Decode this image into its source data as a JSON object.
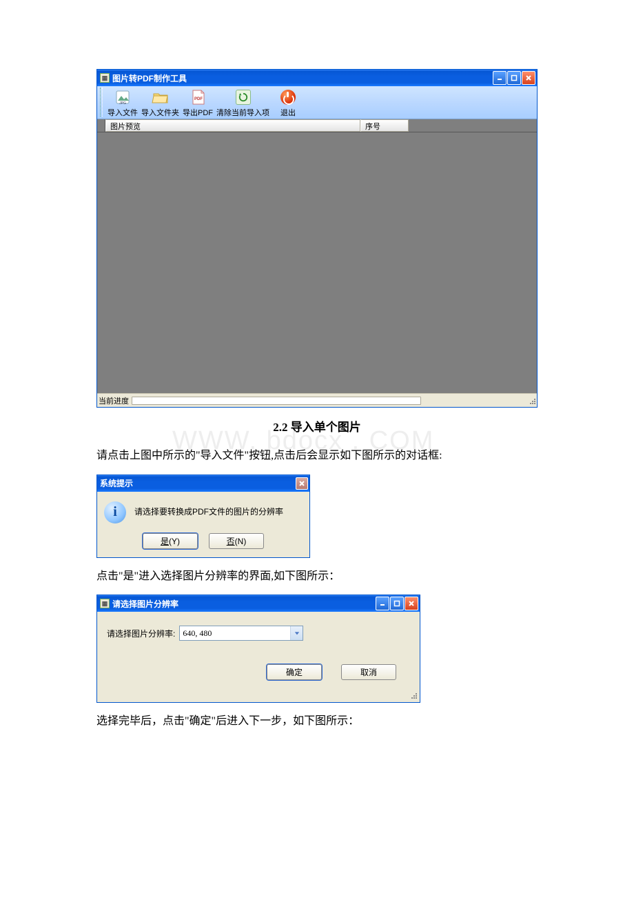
{
  "watermark": "WWW.        bdocx . COM",
  "main_window": {
    "title": "图片转PDF制作工具",
    "toolbar": {
      "import_file": "导入文件",
      "import_folder": "导入文件夹",
      "export_pdf": "导出PDF",
      "clear_current": "清除当前导入项",
      "exit": "退出"
    },
    "columns": {
      "preview": "图片预览",
      "index": "序号"
    },
    "status_label": "当前进度"
  },
  "section_heading": "2.2 导入单个图片",
  "para1": "请点击上图中所示的\"导入文件\"按钮,点击后会显示如下图所示的对话框:",
  "dialog1": {
    "title": "系统提示",
    "message": "请选择要转换成PDF文件的图片的分辨率",
    "yes_label": "是",
    "yes_key": "(Y)",
    "no_label": "否",
    "no_key": "(N)"
  },
  "para2": "点击\"是\"进入选择图片分辨率的界面,如下图所示：",
  "dialog2": {
    "title": "请选择图片分辨率",
    "field_label": "请选择图片分辨率:",
    "selected_value": "640, 480",
    "ok_label": "确定",
    "cancel_label": "取消"
  },
  "para3": "选择完毕后，点击\"确定\"后进入下一步，如下图所示："
}
